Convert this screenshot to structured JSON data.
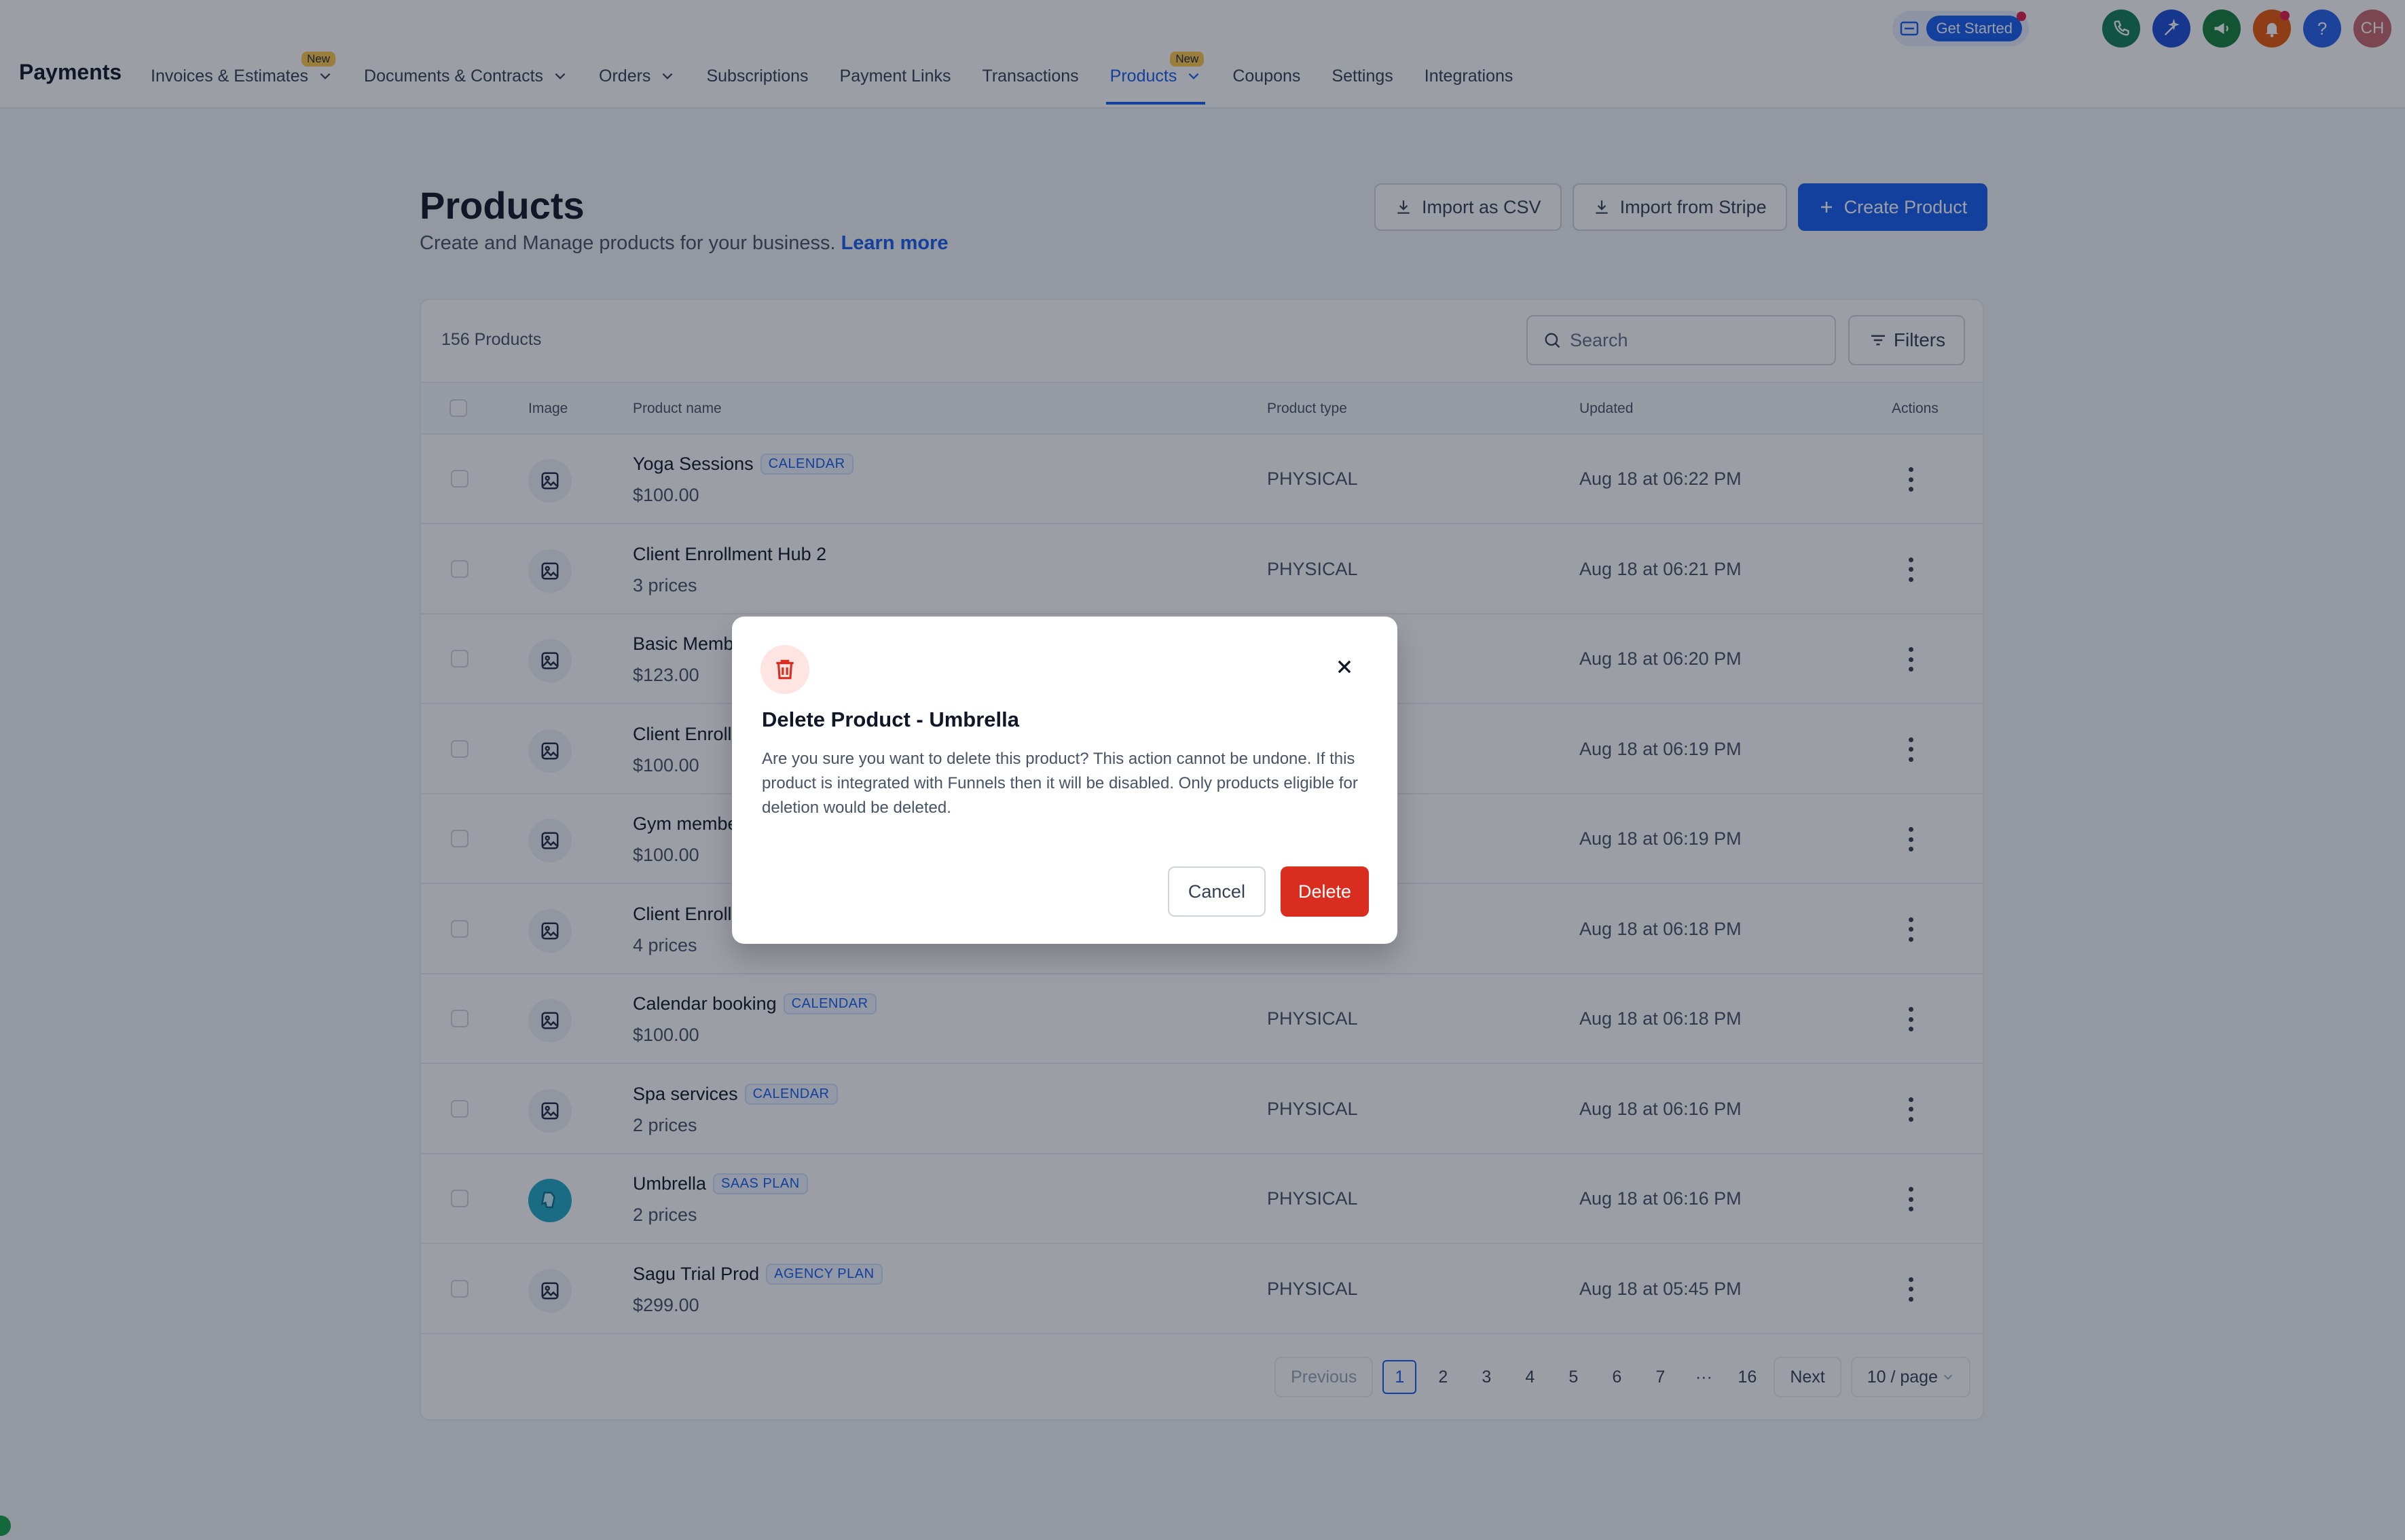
{
  "header": {
    "brand": "Payments",
    "nav": [
      {
        "label": "Invoices & Estimates",
        "dropdown": true,
        "badge": "New"
      },
      {
        "label": "Documents & Contracts",
        "dropdown": true
      },
      {
        "label": "Orders",
        "dropdown": true
      },
      {
        "label": "Subscriptions"
      },
      {
        "label": "Payment Links"
      },
      {
        "label": "Transactions"
      },
      {
        "label": "Products",
        "dropdown": true,
        "badge": "New",
        "active": true
      },
      {
        "label": "Coupons"
      },
      {
        "label": "Settings"
      },
      {
        "label": "Integrations"
      }
    ],
    "get_started": "Get Started",
    "avatar_initials": "CH",
    "help_label": "?"
  },
  "page": {
    "title": "Products",
    "subtitle": "Create and Manage products for your business.",
    "learn_more": "Learn more",
    "import_csv": "Import as CSV",
    "import_stripe": "Import from Stripe",
    "create_product": "Create Product"
  },
  "table": {
    "count": "156 Products",
    "search_placeholder": "Search",
    "filters": "Filters",
    "columns": {
      "image": "Image",
      "name": "Product name",
      "type": "Product type",
      "updated": "Updated",
      "actions": "Actions"
    },
    "rows": [
      {
        "name": "Yoga Sessions",
        "tag": "CALENDAR",
        "sub": "$100.00",
        "type": "PHYSICAL",
        "updated": "Aug 18 at 06:22 PM"
      },
      {
        "name": "Client Enrollment Hub 2",
        "tag": "",
        "sub": "3 prices",
        "type": "PHYSICAL",
        "updated": "Aug 18 at 06:21 PM"
      },
      {
        "name": "Basic Memb",
        "tag": "",
        "sub": "$123.00",
        "type": "",
        "updated": "Aug 18 at 06:20 PM"
      },
      {
        "name": "Client Enroll",
        "tag": "",
        "sub": "$100.00",
        "type": "",
        "updated": "Aug 18 at 06:19 PM"
      },
      {
        "name": "Gym membe",
        "tag": "",
        "sub": "$100.00",
        "type": "",
        "updated": "Aug 18 at 06:19 PM"
      },
      {
        "name": "Client Enrollm",
        "tag": "",
        "sub": "4 prices",
        "type": "",
        "updated": "Aug 18 at 06:18 PM"
      },
      {
        "name": "Calendar booking",
        "tag": "CALENDAR",
        "sub": "$100.00",
        "type": "PHYSICAL",
        "updated": "Aug 18 at 06:18 PM"
      },
      {
        "name": "Spa services",
        "tag": "CALENDAR",
        "sub": "2 prices",
        "type": "PHYSICAL",
        "updated": "Aug 18 at 06:16 PM"
      },
      {
        "name": "Umbrella",
        "tag": "SAAS PLAN",
        "sub": "2 prices",
        "type": "PHYSICAL",
        "updated": "Aug 18 at 06:16 PM",
        "custom_image": true
      },
      {
        "name": "Sagu Trial Prod",
        "tag": "AGENCY PLAN",
        "sub": "$299.00",
        "type": "PHYSICAL",
        "updated": "Aug 18 at 05:45 PM"
      }
    ]
  },
  "pagination": {
    "previous": "Previous",
    "pages": [
      "1",
      "2",
      "3",
      "4",
      "5",
      "6",
      "7",
      "···",
      "16"
    ],
    "current": "1",
    "next": "Next",
    "page_size": "10 / page"
  },
  "modal": {
    "title": "Delete Product - Umbrella",
    "body": "Are you sure you want to delete this product? This action cannot be undone. If this product is integrated with Funnels then it will be disabled. Only products eligible for deletion would be deleted.",
    "cancel": "Cancel",
    "delete": "Delete"
  },
  "colors": {
    "primary": "#155eef",
    "danger": "#d92d20",
    "phone": "#12805c",
    "ai": "#1d4ed8",
    "megaphone": "#15803d",
    "bell": "#ea580c",
    "help": "#2563eb",
    "avatar": "#c8666f"
  }
}
